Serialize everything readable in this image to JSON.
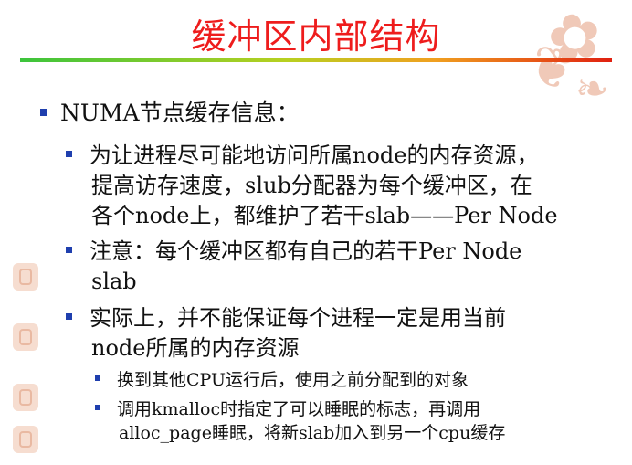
{
  "slide": {
    "title": "缓冲区内部结构",
    "bullets": [
      {
        "text": "NUMA节点缓存信息：",
        "children": [
          {
            "lines": [
              "为让进程尽可能地访问所属node的内存资源，",
              "提高访存速度，slub分配器为每个缓冲区，在",
              "各个node上，都维护了若干slab——Per Node"
            ]
          },
          {
            "lines": [
              "注意：每个缓冲区都有自己的若干Per Node",
              "slab"
            ]
          },
          {
            "lines": [
              "实际上，并不能保证每个进程一定是用当前",
              "node所属的内存资源"
            ],
            "children": [
              {
                "lines": [
                  "换到其他CPU运行后，使用之前分配到的对象"
                ]
              },
              {
                "lines": [
                  "调用kmalloc时指定了可以睡眠的标志，再调用",
                  "alloc_page睡眠，将新slab加入到另一个cpu缓存"
                ]
              }
            ]
          }
        ]
      }
    ]
  },
  "colors": {
    "title": "#ee1c1c",
    "bullet": "#1f3fae",
    "rule_start": "#3cc43c",
    "rule_end": "#e02010",
    "decoration": "#f0c9b8"
  }
}
